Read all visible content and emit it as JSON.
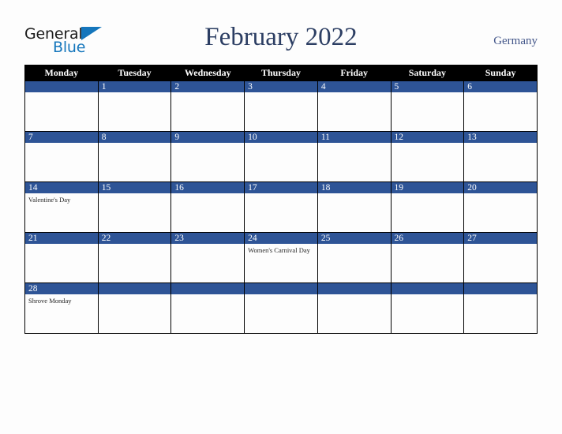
{
  "brand": {
    "logo_word_1": "General",
    "logo_word_2": "Blue",
    "logo_triangle_color": "#1576bc",
    "logo_text_color": "#1b1b1b"
  },
  "header": {
    "title": "February 2022",
    "country": "Germany",
    "title_color": "#2c3e63",
    "country_color": "#44578a"
  },
  "calendar": {
    "month": "February",
    "year": "2022",
    "week_start": "Monday",
    "header_bg": "#000000",
    "daynum_bg": "#2e5496",
    "cell_bg": "#fdfdfd",
    "weekdays": [
      "Monday",
      "Tuesday",
      "Wednesday",
      "Thursday",
      "Friday",
      "Saturday",
      "Sunday"
    ],
    "weeks": [
      [
        {
          "day": "",
          "events": []
        },
        {
          "day": "1",
          "events": []
        },
        {
          "day": "2",
          "events": []
        },
        {
          "day": "3",
          "events": []
        },
        {
          "day": "4",
          "events": []
        },
        {
          "day": "5",
          "events": []
        },
        {
          "day": "6",
          "events": []
        }
      ],
      [
        {
          "day": "7",
          "events": []
        },
        {
          "day": "8",
          "events": []
        },
        {
          "day": "9",
          "events": []
        },
        {
          "day": "10",
          "events": []
        },
        {
          "day": "11",
          "events": []
        },
        {
          "day": "12",
          "events": []
        },
        {
          "day": "13",
          "events": []
        }
      ],
      [
        {
          "day": "14",
          "events": [
            "Valentine's Day"
          ]
        },
        {
          "day": "15",
          "events": []
        },
        {
          "day": "16",
          "events": []
        },
        {
          "day": "17",
          "events": []
        },
        {
          "day": "18",
          "events": []
        },
        {
          "day": "19",
          "events": []
        },
        {
          "day": "20",
          "events": []
        }
      ],
      [
        {
          "day": "21",
          "events": []
        },
        {
          "day": "22",
          "events": []
        },
        {
          "day": "23",
          "events": []
        },
        {
          "day": "24",
          "events": [
            "Women's Carnival Day"
          ]
        },
        {
          "day": "25",
          "events": []
        },
        {
          "day": "26",
          "events": []
        },
        {
          "day": "27",
          "events": []
        }
      ],
      [
        {
          "day": "28",
          "events": [
            "Shrove Monday"
          ]
        },
        {
          "day": "",
          "events": []
        },
        {
          "day": "",
          "events": []
        },
        {
          "day": "",
          "events": []
        },
        {
          "day": "",
          "events": []
        },
        {
          "day": "",
          "events": []
        },
        {
          "day": "",
          "events": []
        }
      ]
    ]
  }
}
